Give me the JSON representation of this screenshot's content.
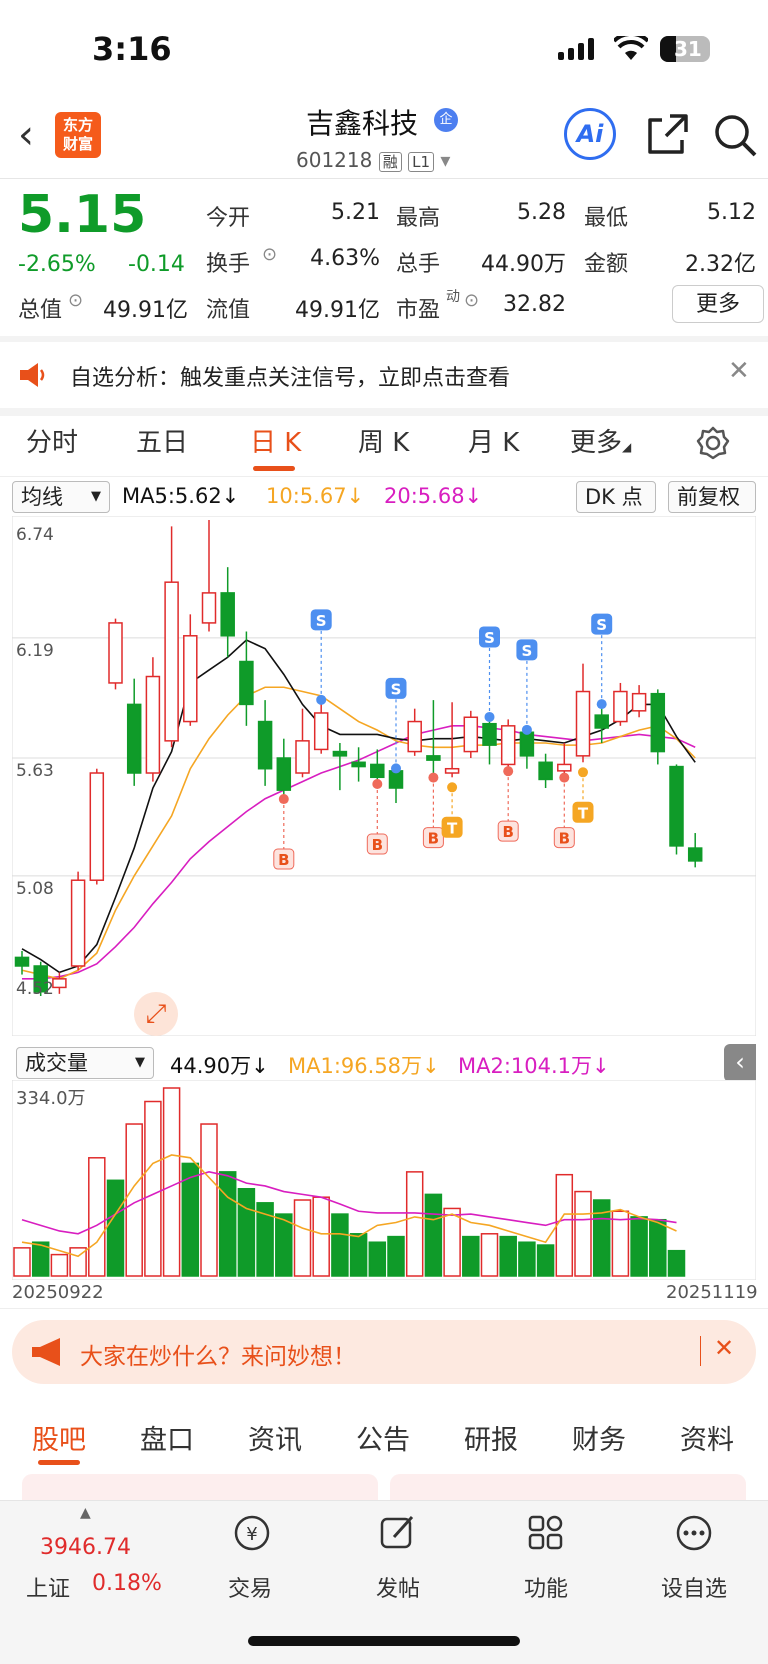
{
  "status_bar": {
    "time": "3:16",
    "battery": "31"
  },
  "header": {
    "logo_text_1": "东方",
    "logo_text_2": "财富",
    "name": "吉鑫科技",
    "enterprise_tag": "企",
    "code": "601218",
    "tag_margin": "融",
    "tag_level": "L1",
    "ai_label": "Ai"
  },
  "quote": {
    "price": "5.15",
    "change_pct": "-2.65%",
    "change": "-0.14",
    "open_label": "今开",
    "open": "5.21",
    "high_label": "最高",
    "high": "5.28",
    "low_label": "最低",
    "low": "5.12",
    "turnover_label": "换手",
    "turnover": "4.63%",
    "volume_label": "总手",
    "volume": "44.90万",
    "amount_label": "金额",
    "amount": "2.32亿",
    "mktcap_label": "总值",
    "mktcap": "49.91亿",
    "float_label": "流值",
    "float": "49.91亿",
    "pe_label": "市盈",
    "pe_sup": "动",
    "pe": "32.82",
    "more": "更多"
  },
  "banner": {
    "text": "自选分析：触发重点关注信号，立即点击查看"
  },
  "ktabs": [
    "分时",
    "五日",
    "日 K",
    "周 K",
    "月 K",
    "更多"
  ],
  "indicators": {
    "main_select": "均线",
    "ma5": "MA5:5.62↓",
    "ma10": "10:5.67↓",
    "ma20": "20:5.68↓",
    "dk": "DK 点",
    "adjust": "前复权",
    "vol_select": "成交量",
    "vol": "44.90万↓",
    "vol_ma1": "MA1:96.58万↓",
    "vol_ma2": "MA2:104.1万↓",
    "vol_max": "334.0万",
    "date_start": "20250922",
    "date_end": "20251119"
  },
  "chart_data": {
    "type": "candlestick",
    "y_ticks": [
      "6.74",
      "6.19",
      "5.63",
      "5.08",
      "4.52"
    ],
    "ylim": [
      4.52,
      6.74
    ],
    "candles": [
      {
        "o": 4.7,
        "c": 4.66,
        "h": 4.73,
        "l": 4.62
      },
      {
        "o": 4.66,
        "c": 4.54,
        "h": 4.68,
        "l": 4.52
      },
      {
        "o": 4.56,
        "c": 4.6,
        "h": 4.63,
        "l": 4.53
      },
      {
        "o": 4.66,
        "c": 5.06,
        "h": 5.1,
        "l": 4.64
      },
      {
        "o": 5.06,
        "c": 5.56,
        "h": 5.58,
        "l": 5.04
      },
      {
        "o": 5.98,
        "c": 6.26,
        "h": 6.28,
        "l": 5.95
      },
      {
        "o": 5.88,
        "c": 5.56,
        "h": 6.0,
        "l": 5.5
      },
      {
        "o": 5.56,
        "c": 6.01,
        "h": 6.1,
        "l": 5.52
      },
      {
        "o": 5.71,
        "c": 6.45,
        "h": 6.71,
        "l": 5.68
      },
      {
        "o": 5.8,
        "c": 6.2,
        "h": 6.3,
        "l": 5.78
      },
      {
        "o": 6.26,
        "c": 6.4,
        "h": 6.74,
        "l": 6.22
      },
      {
        "o": 6.4,
        "c": 6.2,
        "h": 6.52,
        "l": 6.1
      },
      {
        "o": 6.08,
        "c": 5.88,
        "h": 6.22,
        "l": 5.78
      },
      {
        "o": 5.8,
        "c": 5.58,
        "h": 5.9,
        "l": 5.5
      },
      {
        "o": 5.63,
        "c": 5.48,
        "h": 5.72,
        "l": 5.42
      },
      {
        "o": 5.56,
        "c": 5.71,
        "h": 5.86,
        "l": 5.54
      },
      {
        "o": 5.67,
        "c": 5.84,
        "h": 5.92,
        "l": 5.65
      },
      {
        "o": 5.66,
        "c": 5.64,
        "h": 5.7,
        "l": 5.48
      },
      {
        "o": 5.61,
        "c": 5.59,
        "h": 5.68,
        "l": 5.52
      },
      {
        "o": 5.6,
        "c": 5.54,
        "h": 5.67,
        "l": 5.49
      },
      {
        "o": 5.57,
        "c": 5.49,
        "h": 5.6,
        "l": 5.42
      },
      {
        "o": 5.66,
        "c": 5.8,
        "h": 5.86,
        "l": 5.64
      },
      {
        "o": 5.64,
        "c": 5.62,
        "h": 5.9,
        "l": 5.52
      },
      {
        "o": 5.56,
        "c": 5.58,
        "h": 5.89,
        "l": 5.54
      },
      {
        "o": 5.66,
        "c": 5.82,
        "h": 5.85,
        "l": 5.63
      },
      {
        "o": 5.79,
        "c": 5.69,
        "h": 5.84,
        "l": 5.6
      },
      {
        "o": 5.6,
        "c": 5.78,
        "h": 5.81,
        "l": 5.55
      },
      {
        "o": 5.75,
        "c": 5.64,
        "h": 5.78,
        "l": 5.58
      },
      {
        "o": 5.61,
        "c": 5.53,
        "h": 5.65,
        "l": 5.49
      },
      {
        "o": 5.57,
        "c": 5.6,
        "h": 5.7,
        "l": 5.52
      },
      {
        "o": 5.64,
        "c": 5.94,
        "h": 6.07,
        "l": 5.61
      },
      {
        "o": 5.83,
        "c": 5.77,
        "h": 5.9,
        "l": 5.7
      },
      {
        "o": 5.8,
        "c": 5.94,
        "h": 5.98,
        "l": 5.78
      },
      {
        "o": 5.85,
        "c": 5.93,
        "h": 5.97,
        "l": 5.82
      },
      {
        "o": 5.93,
        "c": 5.66,
        "h": 5.95,
        "l": 5.6
      },
      {
        "o": 5.59,
        "c": 5.22,
        "h": 5.6,
        "l": 5.18
      },
      {
        "o": 5.21,
        "c": 5.15,
        "h": 5.28,
        "l": 5.12
      }
    ],
    "ma5": [
      4.74,
      4.69,
      4.63,
      4.66,
      4.76,
      4.98,
      5.21,
      5.49,
      5.66,
      5.98,
      6.04,
      6.1,
      6.18,
      6.14,
      6.02,
      5.88,
      5.78,
      5.74,
      5.74,
      5.74,
      5.72,
      5.71,
      5.72,
      5.72,
      5.73,
      5.72,
      5.71,
      5.72,
      5.71,
      5.7,
      5.73,
      5.76,
      5.81,
      5.88,
      5.88,
      5.73,
      5.61
    ],
    "ma10": [
      4.64,
      4.62,
      4.6,
      4.64,
      4.72,
      4.92,
      5.08,
      5.22,
      5.36,
      5.58,
      5.72,
      5.83,
      5.92,
      5.96,
      5.96,
      5.94,
      5.92,
      5.86,
      5.8,
      5.76,
      5.71,
      5.69,
      5.68,
      5.68,
      5.69,
      5.69,
      5.7,
      5.7,
      5.7,
      5.69,
      5.69,
      5.7,
      5.73,
      5.76,
      5.78,
      5.72,
      5.63
    ],
    "ma20": [
      4.6,
      4.6,
      4.61,
      4.63,
      4.67,
      4.75,
      4.84,
      4.95,
      5.05,
      5.16,
      5.24,
      5.31,
      5.38,
      5.44,
      5.48,
      5.52,
      5.56,
      5.59,
      5.62,
      5.66,
      5.7,
      5.74,
      5.76,
      5.78,
      5.78,
      5.77,
      5.76,
      5.74,
      5.73,
      5.72,
      5.71,
      5.72,
      5.73,
      5.74,
      5.73,
      5.72,
      5.68
    ],
    "signals": [
      {
        "i": 14,
        "label": "B"
      },
      {
        "i": 19,
        "label": "B"
      },
      {
        "i": 22,
        "label": "B"
      },
      {
        "i": 23,
        "label": "T"
      },
      {
        "i": 26,
        "label": "B"
      },
      {
        "i": 29,
        "label": "B"
      },
      {
        "i": 30,
        "label": "T"
      },
      {
        "i": 16,
        "label": "S"
      },
      {
        "i": 20,
        "label": "S"
      },
      {
        "i": 25,
        "label": "S"
      },
      {
        "i": 27,
        "label": "S"
      },
      {
        "i": 31,
        "label": "S"
      }
    ],
    "volume": {
      "ylim": [
        0,
        334.0
      ],
      "values": [
        50,
        60,
        38,
        50,
        210,
        170,
        270,
        310,
        334,
        200,
        270,
        185,
        155,
        130,
        110,
        135,
        140,
        110,
        75,
        60,
        70,
        185,
        145,
        120,
        70,
        75,
        70,
        60,
        55,
        180,
        150,
        135,
        115,
        105,
        100,
        45
      ],
      "up": [
        true,
        false,
        true,
        true,
        true,
        false,
        true,
        true,
        true,
        false,
        true,
        false,
        false,
        false,
        false,
        true,
        true,
        false,
        false,
        false,
        false,
        true,
        false,
        true,
        false,
        true,
        false,
        false,
        false,
        true,
        true,
        false,
        true,
        false,
        false,
        false
      ],
      "ma1": [
        60,
        55,
        45,
        35,
        60,
        110,
        160,
        200,
        215,
        210,
        175,
        140,
        120,
        110,
        100,
        85,
        75,
        75,
        70,
        90,
        95,
        105,
        100,
        110,
        95,
        90,
        80,
        70,
        60,
        110,
        110,
        112,
        118,
        105,
        95,
        80
      ],
      "ma2": [
        100,
        90,
        80,
        75,
        90,
        110,
        130,
        145,
        160,
        175,
        185,
        178,
        165,
        160,
        150,
        145,
        140,
        128,
        115,
        112,
        112,
        112,
        110,
        108,
        110,
        105,
        100,
        95,
        90,
        100,
        100,
        102,
        100,
        102,
        100,
        95
      ]
    }
  },
  "ad": {
    "text": "大家在炒什么？来问妙想！"
  },
  "bottom_tabs": [
    "股吧",
    "盘口",
    "资讯",
    "公告",
    "研报",
    "财务",
    "资料"
  ],
  "nav": {
    "index_value": "3946.74",
    "index_name": "上证",
    "index_change": "0.18%",
    "trade": "交易",
    "post": "发帖",
    "func": "功能",
    "watch": "设自选"
  },
  "colors": {
    "up": "#e02b2b",
    "down": "#0f9b29",
    "ma5": "#111111",
    "ma10": "#f5a623",
    "ma20": "#d81ec0",
    "accent": "#e8501a"
  }
}
